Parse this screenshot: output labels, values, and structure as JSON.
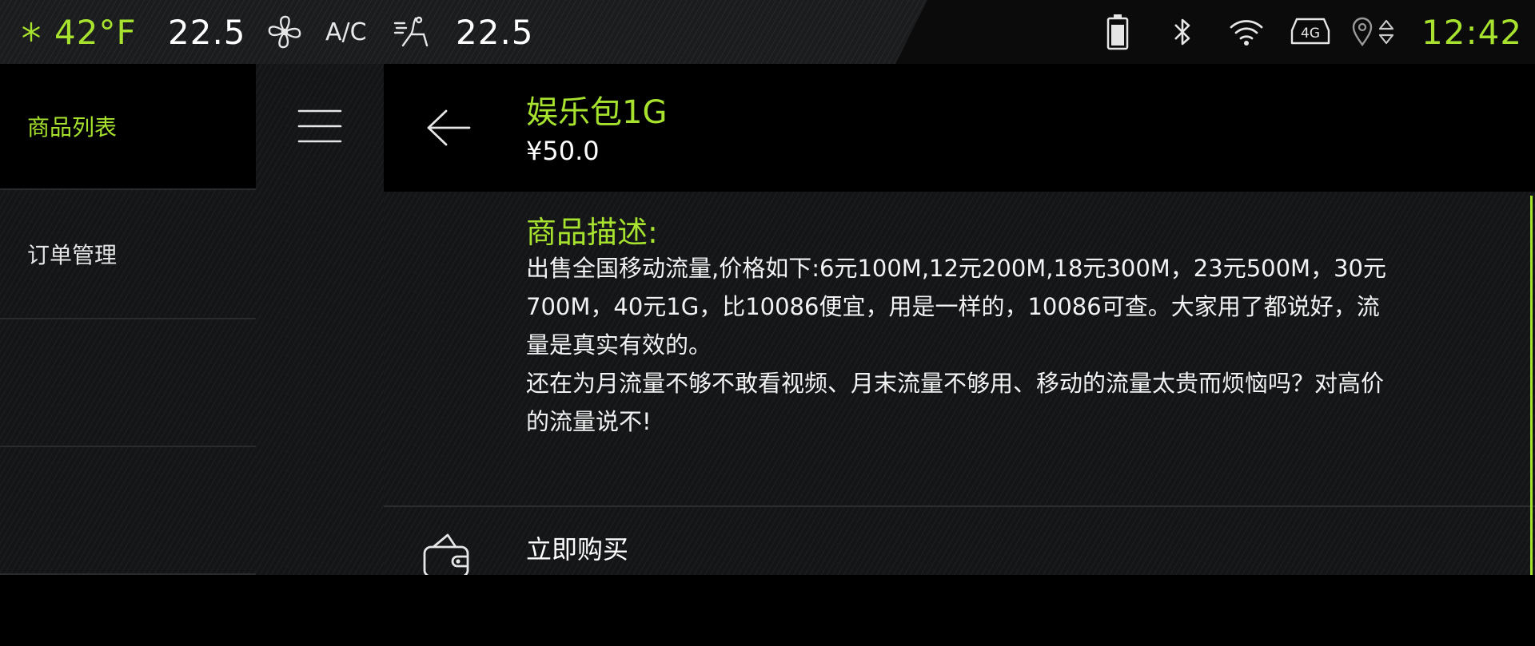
{
  "statusbar": {
    "outside_temp": "42°F",
    "left_temp": "22.5",
    "ac_label": "A/C",
    "right_temp": "22.5",
    "clock": "12:42",
    "network_label": "4G",
    "icons": [
      "snowflake-icon",
      "fan-icon",
      "seat-airflow-icon",
      "battery-icon",
      "bluetooth-icon",
      "wifi-icon",
      "network-4g-icon",
      "location-icon",
      "sort-icon"
    ]
  },
  "sidebar": {
    "items": [
      {
        "label": "商品列表",
        "active": true
      },
      {
        "label": "订单管理",
        "active": false
      }
    ]
  },
  "product": {
    "title": "娱乐包1G",
    "price": "¥50.0",
    "description_label": "商品描述:",
    "description": "出售全国移动流量,价格如下:6元100M,12元200M,18元300M，23元500M，30元700M，40元1G，比10086便宜，用是一样的，10086可查。大家用了都说好，流量是真实有效的。\n还在为月流量不够不敢看视频、月末流量不够用、移动的流量太贵而烦恼吗？对高价的流量说不!"
  },
  "actions": {
    "buy_label": "立即购买"
  },
  "colors": {
    "accent": "#a6e22e",
    "background": "#000000",
    "panel": "#141517"
  }
}
